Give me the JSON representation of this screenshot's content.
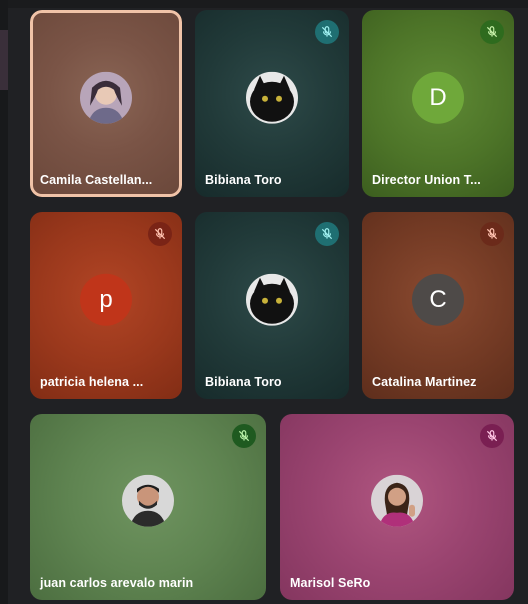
{
  "participants": [
    {
      "name": "Camila Castellan...",
      "avatar": "photo",
      "muted": false,
      "speaking": true
    },
    {
      "name": "Bibiana Toro",
      "avatar": "cat-photo",
      "muted": true
    },
    {
      "name": "Director Union T...",
      "avatar_letter": "D",
      "muted": true
    },
    {
      "name": "patricia helena ...",
      "avatar_letter": "p",
      "muted": true
    },
    {
      "name": "Bibiana Toro",
      "avatar": "cat-photo",
      "muted": true
    },
    {
      "name": "Catalina Martinez",
      "avatar_letter": "C",
      "muted": true
    },
    {
      "name": "juan carlos arevalo marin",
      "avatar": "photo",
      "muted": true
    },
    {
      "name": "Marisol SeRo",
      "avatar": "photo",
      "muted": true
    }
  ],
  "colors": {
    "background": "#202124",
    "speaking_ring": "#f0c3a8",
    "mute_teal": "#1f6f72",
    "mute_green": "#2e6b1e",
    "mute_red": "#7a2416",
    "mute_brown": "#6b2a1a",
    "mute_darkgreen": "#1f5a20",
    "mute_magenta": "#7a1f52"
  },
  "icons": {
    "mute": "mic-off-icon"
  }
}
